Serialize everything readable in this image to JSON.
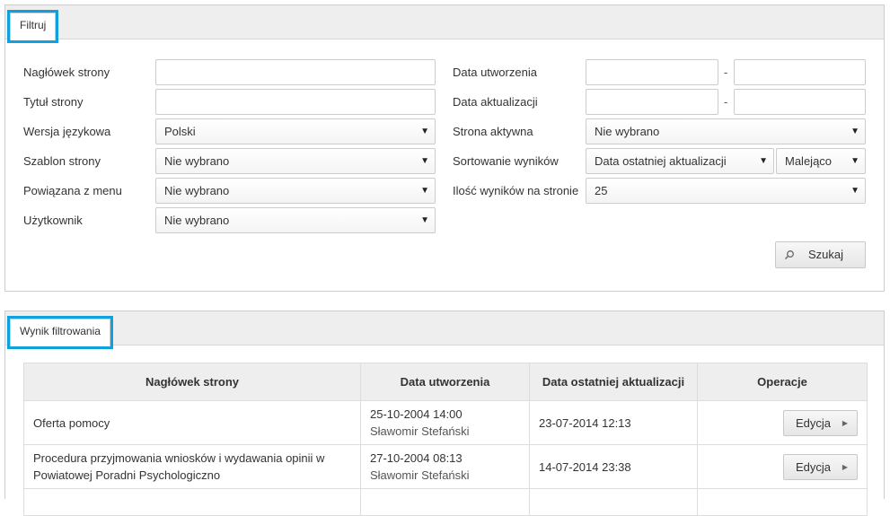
{
  "filter": {
    "tab_label": "Filtruj",
    "left_fields": [
      {
        "label": "Nagłówek strony",
        "kind": "input",
        "value": ""
      },
      {
        "label": "Tytuł strony",
        "kind": "input",
        "value": ""
      },
      {
        "label": "Wersja językowa",
        "kind": "select",
        "value": "Polski"
      },
      {
        "label": "Szablon strony",
        "kind": "select",
        "value": "Nie wybrano"
      },
      {
        "label": "Powiązana z menu",
        "kind": "select",
        "value": "Nie wybrano"
      },
      {
        "label": "Użytkownik",
        "kind": "select",
        "value": "Nie wybrano"
      }
    ],
    "date_created_label": "Data utworzenia",
    "date_updated_label": "Data aktualizacji",
    "date_separator": "-",
    "active_label": "Strona aktywna",
    "active_value": "Nie wybrano",
    "sort_label": "Sortowanie wyników",
    "sort_field_value": "Data ostatniej aktualizacji",
    "sort_order_value": "Malejąco",
    "per_page_label": "Ilość wyników na stronie",
    "per_page_value": "25",
    "search_button": "Szukaj",
    "dropdown_arrow": "▼"
  },
  "results": {
    "tab_label": "Wynik filtrowania",
    "columns": [
      "Nagłówek strony",
      "Data utworzenia",
      "Data ostatniej aktualizacji",
      "Operacje"
    ],
    "rows": [
      {
        "title": "Oferta pomocy",
        "created_date": "25-10-2004 14:00",
        "created_by": "Sławomir Stefański",
        "updated": "23-07-2014 12:13",
        "action": "Edycja"
      },
      {
        "title": "Procedura przyjmowania wniosków i wydawania opinii w Powiatowej Poradni Psychologiczno",
        "created_date": "27-10-2004 08:13",
        "created_by": "Sławomir Stefański",
        "updated": "14-07-2014 23:38",
        "action": "Edycja"
      }
    ]
  },
  "icons": {
    "search": "search-icon",
    "dropdown": "chevron-down-icon",
    "edit_caret": "chevron-right-icon"
  },
  "colors": {
    "tab_highlight": "#0fa0de",
    "panel_header": "#eeeeee",
    "border": "#cccccc"
  }
}
